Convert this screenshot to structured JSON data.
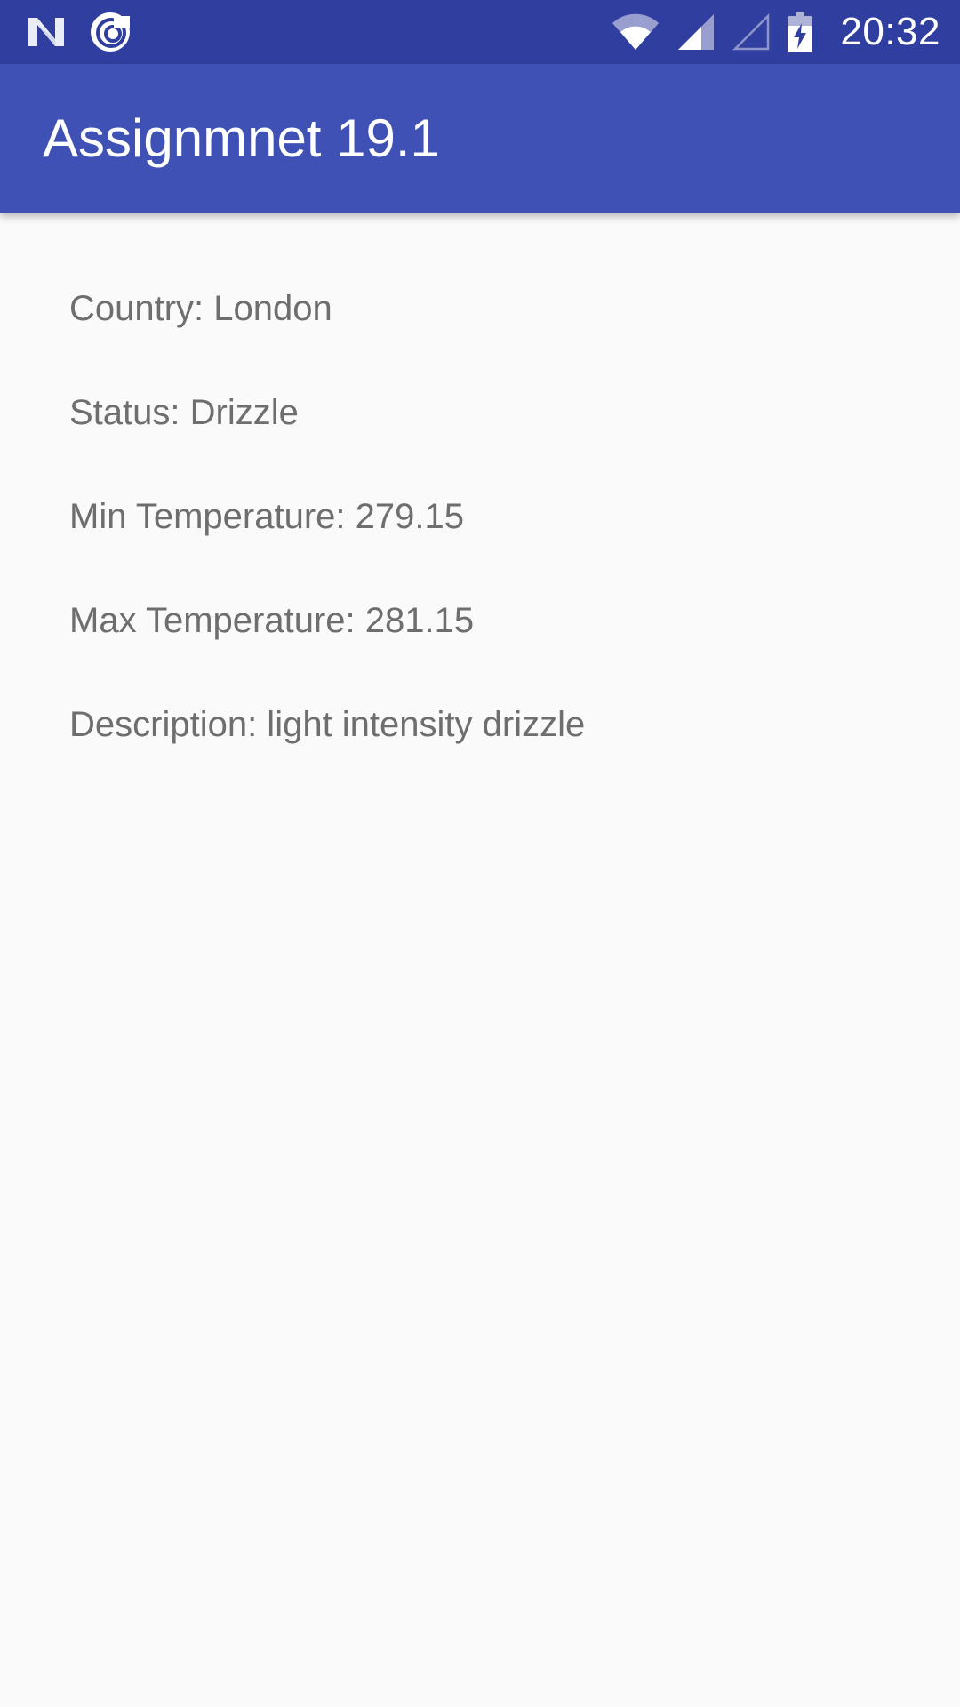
{
  "status_bar": {
    "time": "20:32",
    "left_icons": [
      "n-logo-icon",
      "app-notification-icon"
    ],
    "right_icons": [
      "wifi-icon",
      "signal-icon",
      "signal-empty-icon",
      "battery-charging-icon"
    ]
  },
  "app_bar": {
    "title": "Assignmnet 19.1"
  },
  "weather": {
    "country": "Country: London",
    "status": "Status: Drizzle",
    "min_temp": "Min Temperature: 279.15",
    "max_temp": "Max Temperature: 281.15",
    "description": "Description: light intensity drizzle"
  },
  "colors": {
    "status_bar": "#303f9f",
    "app_bar": "#3f51b5",
    "background": "#fafafa",
    "text": "#6e6e6e"
  }
}
